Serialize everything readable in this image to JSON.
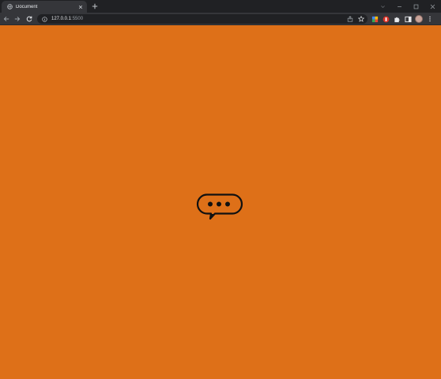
{
  "browser": {
    "tab": {
      "title": "Document",
      "favicon": "globe-icon",
      "close_icon": "close-icon"
    },
    "new_tab_icon": "plus-icon",
    "window_controls": [
      "chevron-down-icon",
      "minimize-icon",
      "maximize-icon",
      "close-icon"
    ],
    "toolbar": {
      "back_icon": "arrow-left-icon",
      "forward_icon": "arrow-right-icon",
      "reload_icon": "reload-icon",
      "address": {
        "host": "127.0.0.1",
        "port": ":5500"
      },
      "omnibox_icons": [
        "share-icon",
        "star-icon"
      ],
      "extension_icons": [
        "extension-colorful-icon",
        "extension-red-icon",
        "puzzle-icon",
        "side-panel-icon"
      ],
      "menu_icon": "kebab-menu-icon"
    }
  },
  "page": {
    "background_color": "#de7018",
    "center_icon": "typing-chat-bubble-icon"
  },
  "colors": {
    "tabstrip": "#202124",
    "toolbar": "#35363a",
    "omnibox": "#202124",
    "page_background": "#de7018",
    "bubble_stroke": "#111111"
  }
}
